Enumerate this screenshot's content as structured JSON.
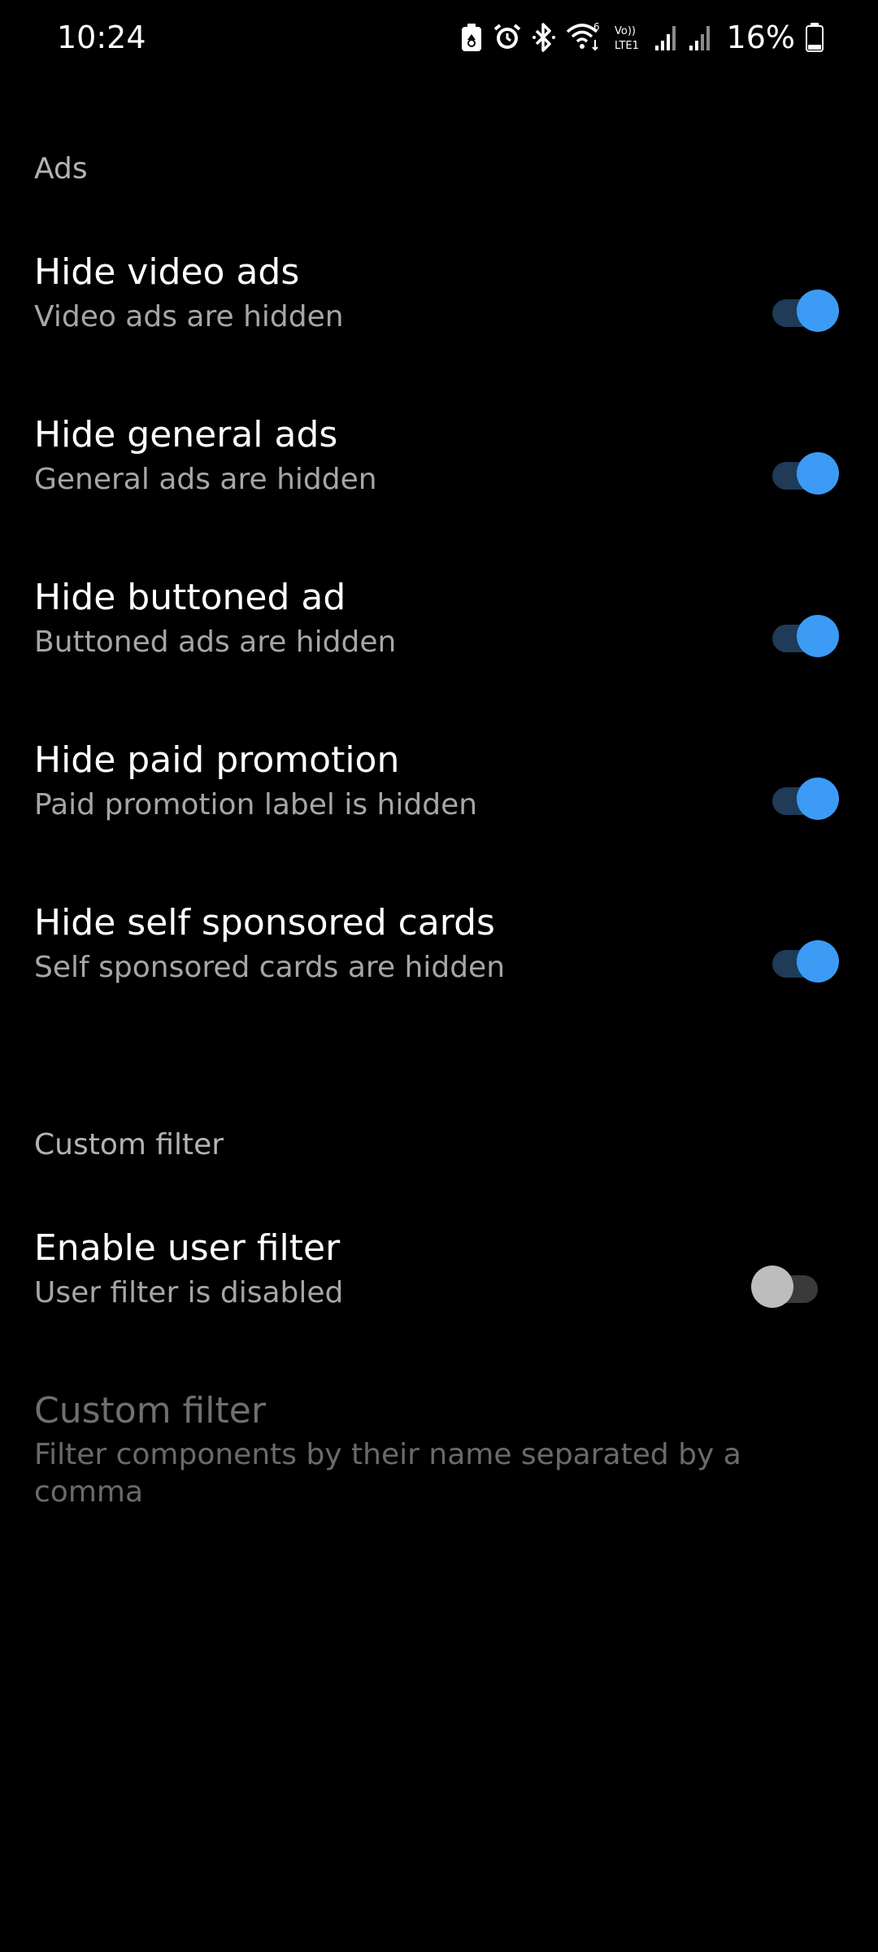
{
  "status_bar": {
    "time": "10:24",
    "battery_percent": "16%",
    "icons": [
      "recycle-notification-icon",
      "alarm-icon",
      "bluetooth-icon",
      "wifi-icon",
      "volte-icon",
      "signal-icon",
      "signal-icon",
      "battery-icon"
    ],
    "volte_label_top": "Vo))",
    "volte_label_bottom": "LTE1",
    "wifi_label": "6"
  },
  "sections": {
    "ads": {
      "header": "Ads",
      "items": [
        {
          "title": "Hide video ads",
          "summary": "Video ads are hidden",
          "enabled": true
        },
        {
          "title": "Hide general ads",
          "summary": "General ads are hidden",
          "enabled": true
        },
        {
          "title": "Hide buttoned ad",
          "summary": "Buttoned ads are hidden",
          "enabled": true
        },
        {
          "title": "Hide paid promotion",
          "summary": "Paid promotion label is hidden",
          "enabled": true
        },
        {
          "title": "Hide self sponsored cards",
          "summary": "Self sponsored cards are hidden",
          "enabled": true
        }
      ]
    },
    "custom_filter": {
      "header": "Custom filter",
      "items": [
        {
          "title": "Enable user filter",
          "summary": "User filter is disabled",
          "enabled": false
        },
        {
          "title": "Custom filter",
          "summary": "Filter components by their name separated by a comma"
        }
      ]
    }
  },
  "colors": {
    "accent": "#3b9bf5",
    "track_on": "#1f3b57",
    "thumb_off": "#bdbdbd",
    "background": "#000000"
  }
}
